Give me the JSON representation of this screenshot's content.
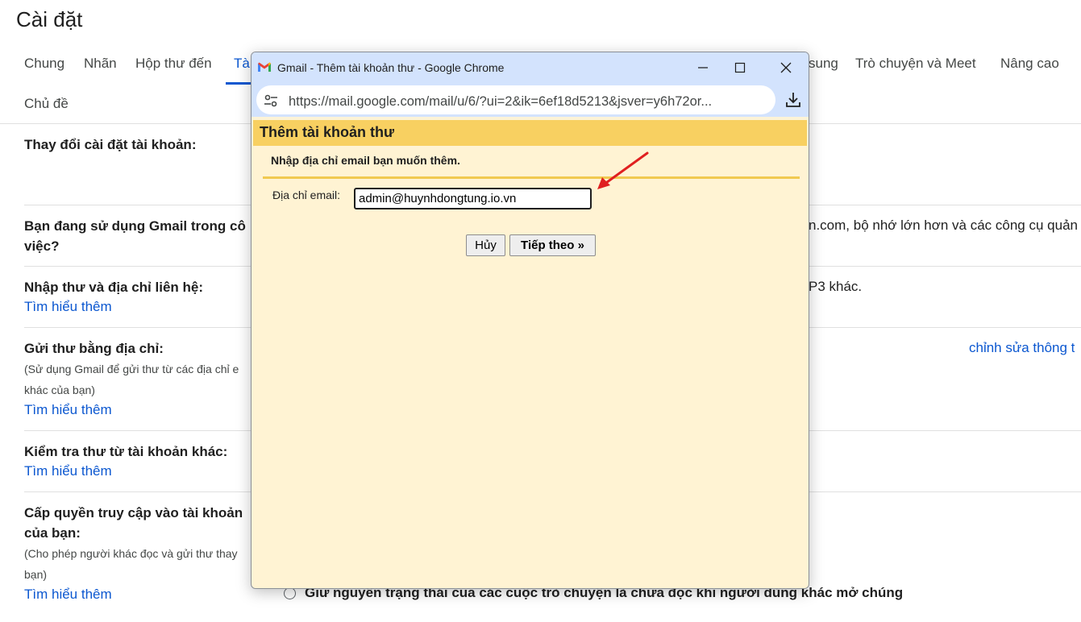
{
  "page": {
    "title": "Cài đặt"
  },
  "tabs": [
    {
      "label": "Chung"
    },
    {
      "label": "Nhãn"
    },
    {
      "label": "Hộp thư đến"
    },
    {
      "label": "Tài"
    },
    {
      "label": "sung"
    },
    {
      "label": "Trò chuyện và Meet"
    },
    {
      "label": "Nâng cao"
    },
    {
      "label": "Chủ đề"
    }
  ],
  "sections": {
    "account_change": {
      "title": "Thay đổi cài đặt tài khoản:"
    },
    "workspace": {
      "title_line1": "Bạn đang sử dụng Gmail trong cô",
      "title_line2": "việc?",
      "right_text": "n.com, bộ nhớ lớn hơn và các công cụ quản"
    },
    "import": {
      "title": "Nhập thư và địa chỉ liên hệ:",
      "link": "Tìm hiểu thêm",
      "right_text": "P3 khác."
    },
    "send_as": {
      "title": "Gửi thư bằng địa chỉ:",
      "note_line1": "(Sử dụng Gmail để gửi thư từ các địa chỉ e",
      "note_line2": "khác của bạn)",
      "link": "Tìm hiểu thêm",
      "right_link": "chỉnh sửa thông t"
    },
    "check_mail": {
      "title": "Kiểm tra thư từ tài khoản khác:",
      "link": "Tìm hiểu thêm"
    },
    "grant_access": {
      "title_line1": "Cấp quyền truy cập vào tài khoản",
      "title_line2": "của bạn:",
      "note_line1": "(Cho phép người khác đọc và gửi thư thay",
      "note_line2": "bạn)",
      "link": "Tìm hiểu thêm",
      "radio_text": "Giữ nguyên trạng thái của các cuộc trò chuyện là chưa đọc khi người dùng khác mở chúng"
    }
  },
  "popup": {
    "window_title": "Gmail - Thêm tài khoản thư - Google Chrome",
    "url": "https://mail.google.com/mail/u/6/?ui=2&ik=6ef18d5213&jsver=y6h72or...",
    "dialog_title": "Thêm tài khoản thư",
    "instruction": "Nhập địa chỉ email bạn muốn thêm.",
    "email_label": "Địa chỉ email:",
    "email_value": "admin@huynhdongtung.io.vn",
    "cancel_label": "Hủy",
    "next_label": "Tiếp theo »"
  },
  "colors": {
    "link": "#0b57d0",
    "dialog_header": "#f8d061",
    "dialog_body": "#fff3d3",
    "annotation_arrow": "#e02020"
  }
}
